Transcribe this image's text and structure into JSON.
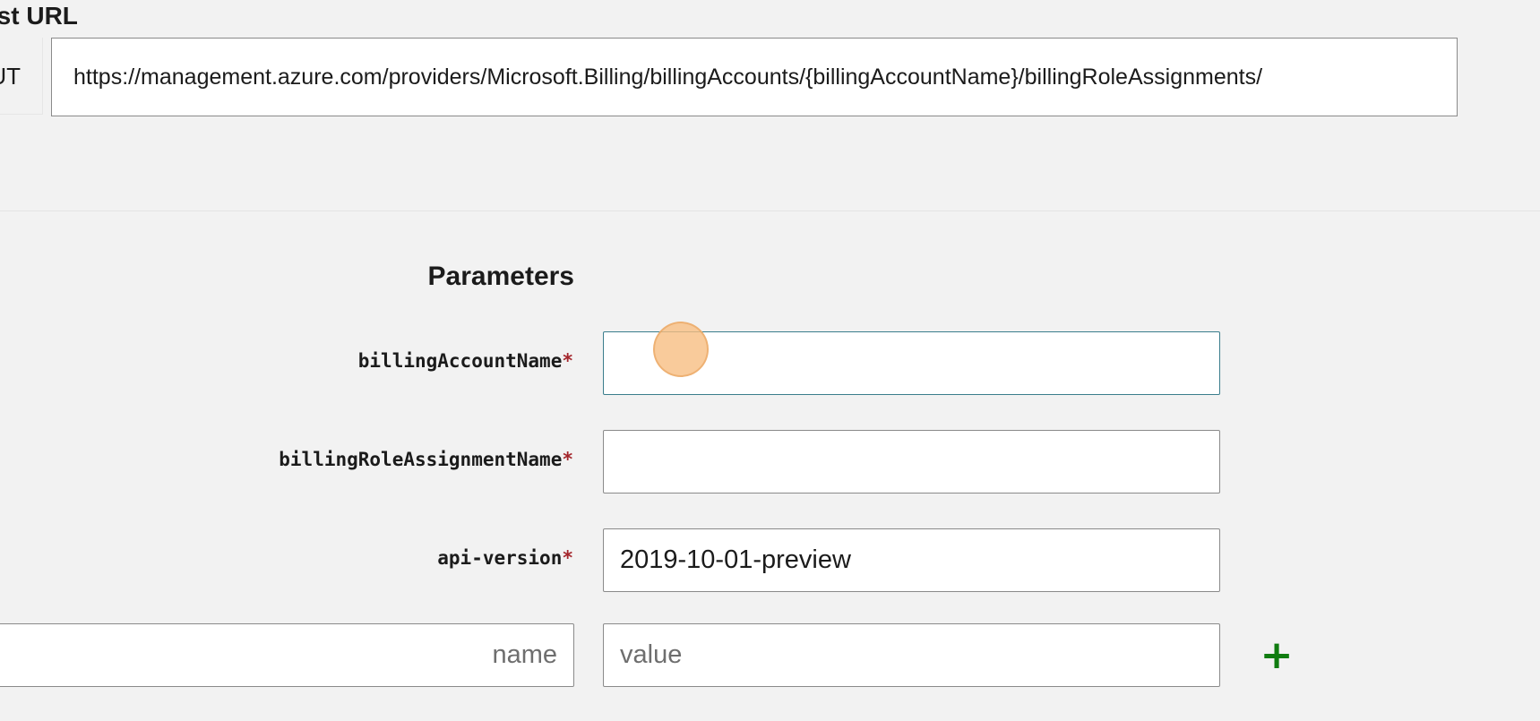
{
  "request_url": {
    "heading": "uest URL",
    "method": "UT",
    "url": "https://management.azure.com/providers/Microsoft.Billing/billingAccounts/{billingAccountName}/billingRoleAssignments/"
  },
  "parameters": {
    "title": "Parameters",
    "required_marker": "*",
    "fields": [
      {
        "label": "billingAccountName",
        "value": "",
        "placeholder": ""
      },
      {
        "label": "billingRoleAssignmentName",
        "value": "",
        "placeholder": ""
      },
      {
        "label": "api-version",
        "value": "2019-10-01-preview",
        "placeholder": ""
      }
    ],
    "custom": {
      "name_placeholder": "name",
      "value_placeholder": "value",
      "add_symbol": "+"
    }
  },
  "colors": {
    "background": "#f2f2f2",
    "required": "#a4262c",
    "add": "#107c10",
    "focus_border": "#3a7d8c"
  },
  "icons": {
    "add": "plus-icon"
  }
}
